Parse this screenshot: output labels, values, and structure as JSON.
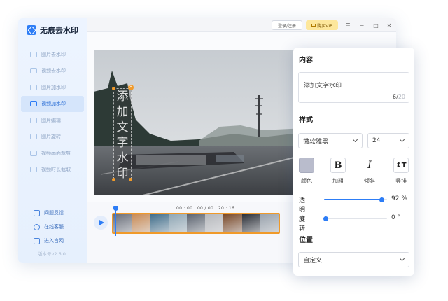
{
  "app": {
    "name": "无痕去水印",
    "version": "版本号v2.6.0"
  },
  "sidebar": {
    "items": [
      {
        "label": "图片去水印",
        "icon": "image-eraser-icon",
        "active": false
      },
      {
        "label": "视频去水印",
        "icon": "video-eraser-icon",
        "active": false
      },
      {
        "label": "图片加水印",
        "icon": "image-watermark-icon",
        "active": false
      },
      {
        "label": "视频加水印",
        "icon": "video-watermark-icon",
        "active": true
      },
      {
        "label": "图片编辑",
        "icon": "image-edit-icon",
        "active": false
      },
      {
        "label": "图片旋转",
        "icon": "image-rotate-icon",
        "active": false
      },
      {
        "label": "视频画面裁剪",
        "icon": "video-crop-icon",
        "active": false
      },
      {
        "label": "视频时长截取",
        "icon": "video-trim-icon",
        "active": false
      }
    ],
    "links": [
      {
        "label": "问题反馈",
        "icon": "feedback-icon"
      },
      {
        "label": "在线客服",
        "icon": "support-icon"
      },
      {
        "label": "进入官网",
        "icon": "website-icon"
      }
    ]
  },
  "titlebar": {
    "login_label": "登录/注册",
    "vip_label": "购买VIP",
    "menu_glyph": "☰",
    "min_glyph": "─",
    "max_glyph": "□",
    "close_glyph": "✕"
  },
  "editor": {
    "watermark_chars": [
      "添",
      "加",
      "文",
      "字",
      "水",
      "印"
    ],
    "close_glyph": "✕",
    "timecode": "00 : 00 : 00 / 00 : 20 : 16",
    "frame_colors": [
      "#6a6f7a",
      "#c98b55",
      "#3f6d8a",
      "#8fa7b5",
      "#5c6470",
      "#b7b9bd",
      "#7a4a2a",
      "#2c3038",
      "#9aa3ad"
    ]
  },
  "panel": {
    "content_title": "内容",
    "text_value": "添加文字水印",
    "char_count": "6",
    "char_max": "20",
    "style_title": "样式",
    "font_family": "微软雅黑",
    "font_size": "24",
    "styles": {
      "color_label": "颜色",
      "bold_label": "加粗",
      "bold_glyph": "B",
      "italic_label": "倾斜",
      "italic_glyph": "I",
      "vertical_label": "竖排",
      "vertical_glyph": "↕T"
    },
    "swatch_color": "#b9bccc",
    "opacity_label": "透明度",
    "opacity_value": 92,
    "opacity_text": "92 %",
    "rotate_label": "旋转",
    "rotate_value": 0,
    "rotate_text": "0 °",
    "position_title": "位置",
    "position_value": "自定义"
  },
  "colors": {
    "accent": "#2d7df6",
    "highlight": "#f09a2a",
    "vip": "#fde79c"
  }
}
